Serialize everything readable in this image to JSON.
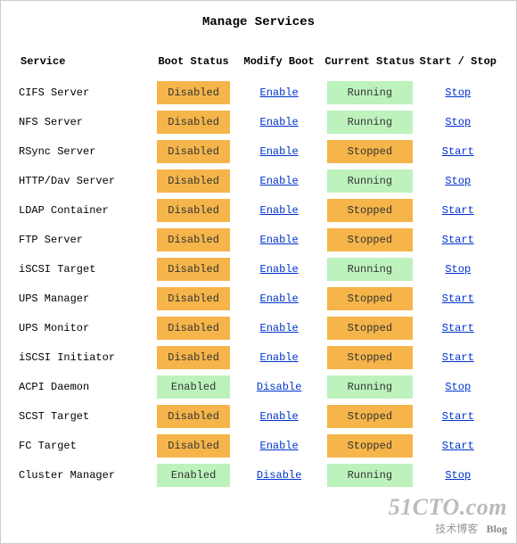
{
  "title": "Manage Services",
  "columns": {
    "name": "Service",
    "boot": "Boot Status",
    "modify": "Modify Boot",
    "status": "Current Status",
    "action": "Start / Stop"
  },
  "status_colors": {
    "enabled": "#bdf2bd",
    "disabled": "#f5b54a",
    "running": "#bdf2bd",
    "stopped": "#f5b54a"
  },
  "labels": {
    "enabled": "Enabled",
    "disabled": "Disabled",
    "running": "Running",
    "stopped": "Stopped",
    "enable": "Enable",
    "disable": "Disable",
    "start": "Start",
    "stop": "Stop"
  },
  "services": [
    {
      "name": "CIFS Server",
      "boot": "disabled",
      "status": "running"
    },
    {
      "name": "NFS Server",
      "boot": "disabled",
      "status": "running"
    },
    {
      "name": "RSync Server",
      "boot": "disabled",
      "status": "stopped"
    },
    {
      "name": "HTTP/Dav Server",
      "boot": "disabled",
      "status": "running"
    },
    {
      "name": "LDAP Container",
      "boot": "disabled",
      "status": "stopped"
    },
    {
      "name": "FTP Server",
      "boot": "disabled",
      "status": "stopped"
    },
    {
      "name": "iSCSI Target",
      "boot": "disabled",
      "status": "running"
    },
    {
      "name": "UPS Manager",
      "boot": "disabled",
      "status": "stopped"
    },
    {
      "name": "UPS Monitor",
      "boot": "disabled",
      "status": "stopped"
    },
    {
      "name": "iSCSI Initiator",
      "boot": "disabled",
      "status": "stopped"
    },
    {
      "name": "ACPI Daemon",
      "boot": "enabled",
      "status": "running"
    },
    {
      "name": "SCST Target",
      "boot": "disabled",
      "status": "stopped"
    },
    {
      "name": "FC Target",
      "boot": "disabled",
      "status": "stopped"
    },
    {
      "name": "Cluster Manager",
      "boot": "enabled",
      "status": "running"
    }
  ],
  "watermark": {
    "main": "51CTO.com",
    "sub_cn": "技术博客",
    "sub_en": "Blog"
  }
}
